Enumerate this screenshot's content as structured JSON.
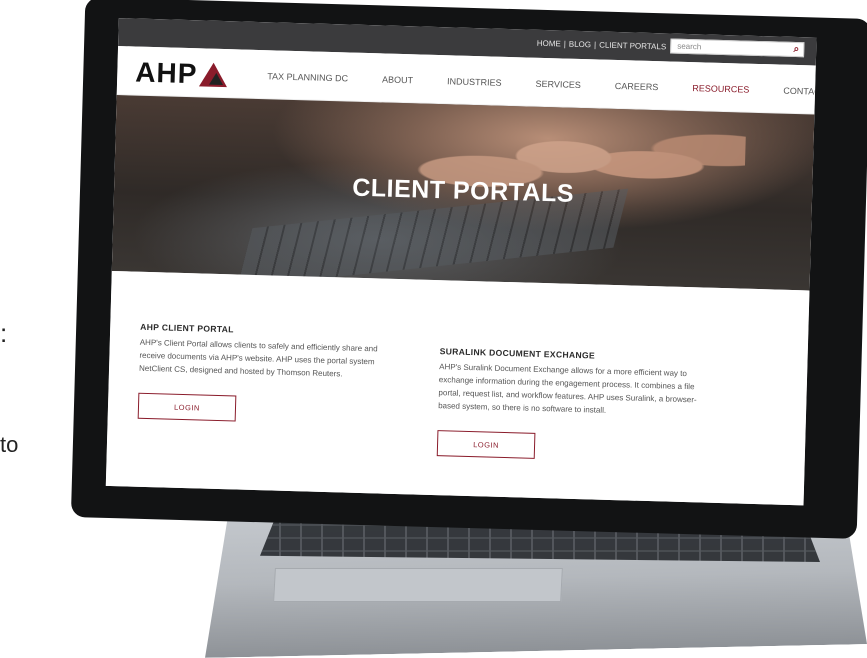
{
  "edge": {
    "colon": ":",
    "to": "to"
  },
  "utility": {
    "links": [
      "HOME",
      "BLOG",
      "CLIENT PORTALS"
    ],
    "separator": "|",
    "search_placeholder": "search"
  },
  "nav": {
    "logo": "AHP",
    "items": [
      "TAX PLANNING DC",
      "ABOUT",
      "INDUSTRIES",
      "SERVICES",
      "CAREERS",
      "RESOURCES",
      "CONTACT"
    ],
    "active_item": "RESOURCES"
  },
  "hero": {
    "title": "CLIENT PORTALS"
  },
  "sections": [
    {
      "title": "AHP CLIENT PORTAL",
      "body": "AHP's Client Portal allows clients to safely and efficiently share and receive documents via AHP's website. AHP uses the portal system NetClient CS, designed and hosted by Thomson Reuters.",
      "button": "LOGIN"
    },
    {
      "title": "SURALINK DOCUMENT EXCHANGE",
      "body": "AHP's Suralink Document Exchange allows for a more efficient way to exchange information during the engagement process. It combines a file portal, request list, and workflow features. AHP uses Suralink, a browser-based system, so there is no software to install.",
      "button": "LOGIN"
    }
  ],
  "colors": {
    "accent": "#8a1c2b",
    "utility_bar": "#3b3b3d"
  }
}
